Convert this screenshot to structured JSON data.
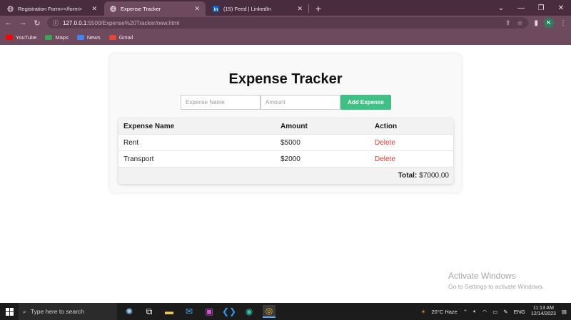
{
  "browser": {
    "tabs": [
      {
        "title": "Registration Form></form>",
        "icon": "globe-icon",
        "active": false
      },
      {
        "title": "Expense Tracker",
        "icon": "globe-icon",
        "active": true
      },
      {
        "title": "(15) Feed | LinkedIn",
        "icon": "linkedin-icon",
        "active": false
      }
    ],
    "url_host": "127.0.0.1",
    "url_path": ":5500/Expense%20Tracker/new.html",
    "profile_initial": "K",
    "bookmarks": [
      {
        "label": "YouTube",
        "color": "#ff0000"
      },
      {
        "label": "Maps",
        "color": "#34a853"
      },
      {
        "label": "News",
        "color": "#4285f4"
      },
      {
        "label": "Gmail",
        "color": "#ea4335"
      }
    ]
  },
  "app": {
    "title": "Expense Tracker",
    "name_placeholder": "Expense Name",
    "amount_placeholder": "Amount",
    "add_label": "Add Expense",
    "table": {
      "headers": [
        "Expense Name",
        "Amount",
        "Action"
      ],
      "rows": [
        {
          "name": "Rent",
          "amount": "$5000",
          "action": "Delete"
        },
        {
          "name": "Transport",
          "amount": "$2000",
          "action": "Delete"
        }
      ],
      "total_label": "Total:",
      "total_value": "$7000.00"
    },
    "accent": "#3fc186",
    "delete_color": "#e53935"
  },
  "watermark": {
    "line1": "Activate Windows",
    "line2": "Go to Settings to activate Windows."
  },
  "taskbar": {
    "search_placeholder": "Type here to search",
    "weather": "20°C  Haze",
    "lang": "ENG",
    "time": "11:13 AM",
    "date": "12/14/2023"
  }
}
